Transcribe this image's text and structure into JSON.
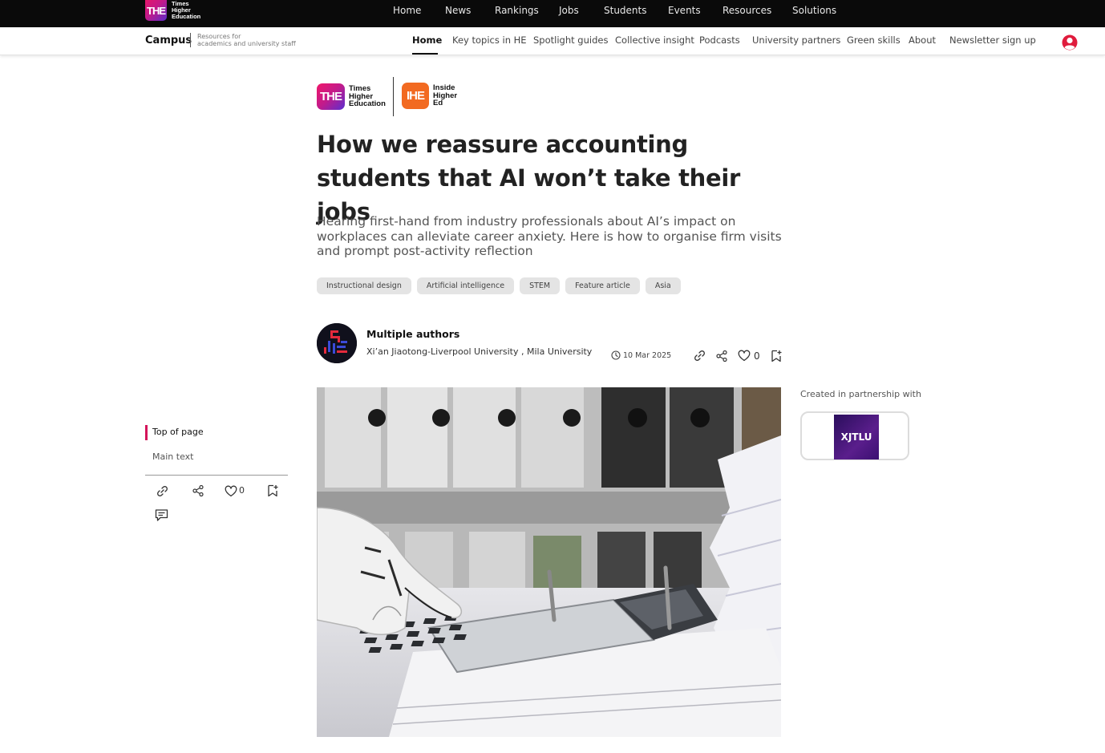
{
  "brand": {
    "badge": "THE",
    "name_lines": [
      "Times",
      "Higher",
      "Education"
    ]
  },
  "topnav": [
    "Home",
    "News",
    "Rankings",
    "Jobs",
    "Students",
    "Events",
    "Resources",
    "Solutions"
  ],
  "campus": {
    "title": "Campus",
    "subtitle_lines": [
      "Resources for",
      "academics and university staff"
    ]
  },
  "subnav": [
    "Home",
    "Key topics in HE",
    "Spotlight guides",
    "Collective insight",
    "Podcasts",
    "University partners",
    "Green skills",
    "About",
    "Newsletter sign up"
  ],
  "partner_logos": {
    "the_badge": "THE",
    "the_lines": [
      "Times",
      "Higher",
      "Education"
    ],
    "ihe_badge": "IHE",
    "ihe_lines": [
      "Inside",
      "Higher",
      "Ed"
    ]
  },
  "article": {
    "headline": "How we reassure accounting students that AI won’t take their jobs",
    "standfirst": "Hearing first-hand from industry professionals about AI’s impact on workplaces can alleviate career anxiety. Here is how to organise firm visits and prompt post-activity reflection",
    "tags": [
      "Instructional design",
      "Artificial intelligence",
      "STEM",
      "Feature article",
      "Asia"
    ],
    "author_name": "Multiple authors",
    "author_affiliation": "Xi’an Jiaotong-Liverpool University , Mila University",
    "date": "10 Mar 2025",
    "like_count": "0"
  },
  "sidebar": {
    "toc": [
      "Top of page",
      "Main text"
    ],
    "like_count": "0"
  },
  "partnership": {
    "label": "Created in partnership with",
    "partner_name": "XJTLU"
  },
  "colors": {
    "accent": "#d4145a",
    "topbar": "#0a0a0a",
    "ihe_orange": "#f26a21",
    "user_icon": "#e01b3c"
  },
  "icons": [
    "user-icon",
    "link-icon",
    "share-icon",
    "heart-icon",
    "bookmark-add-icon",
    "clock-icon",
    "comment-icon"
  ]
}
